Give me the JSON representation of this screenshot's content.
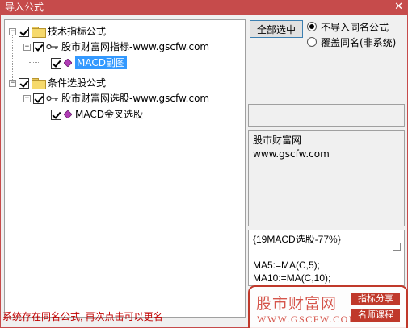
{
  "window": {
    "title": "导入公式",
    "close_glyph": "✕"
  },
  "tree": {
    "groups": [
      {
        "label": "技术指标公式",
        "expander": "−",
        "source": {
          "label": "股市财富网指标-www.gscfw.com",
          "expander": "−"
        },
        "formula": {
          "label": "MACD副图"
        }
      },
      {
        "label": "条件选股公式",
        "expander": "−",
        "source": {
          "label": "股市财富网选股-www.gscfw.com",
          "expander": "−"
        },
        "formula": {
          "label": "MACD金叉选股"
        }
      }
    ]
  },
  "actions": {
    "select_all_label": "全部选中"
  },
  "options": {
    "no_import_same_name": "不导入同名公式",
    "overwrite_same_name": "覆盖同名(非系统)"
  },
  "author": {
    "line1": "股市财富网",
    "line2": "www.gscfw.com"
  },
  "code": {
    "lines": [
      "{19MACD选股-77%}",
      "",
      "MA5:=MA(C,5);",
      "MA10:=MA(C,10);"
    ]
  },
  "status": {
    "message": "系统存在同名公式, 再次点击可以更名"
  },
  "watermark": {
    "name": "股市财富网",
    "url": "WWW.GSCFW.COM",
    "tag1": "指标分享",
    "tag2": "名师课程"
  },
  "colors": {
    "title_bar": "#c64b4b",
    "selection": "#3399ff",
    "status_text": "#c00000",
    "brand": "#c0392b"
  }
}
